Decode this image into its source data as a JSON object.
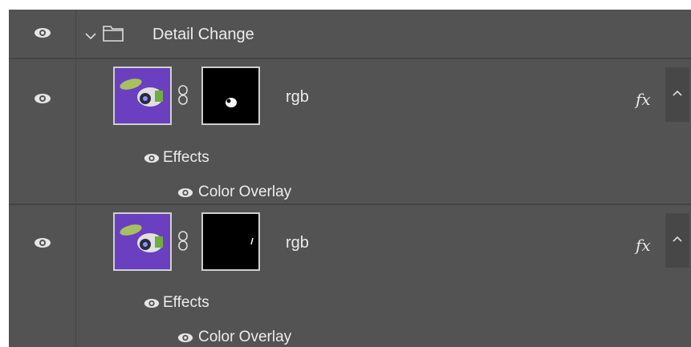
{
  "group": {
    "name": "Detail Change",
    "disclosure_icon": "chevron-down-icon",
    "folder_icon": "folder-icon",
    "visibility_icon": "eye-icon"
  },
  "layers": [
    {
      "name": "rgb",
      "fx_label": "fx",
      "effects_label": "Effects",
      "effect_items": [
        "Color Overlay"
      ],
      "visibility_icon": "eye-icon",
      "mask_icon": "link-icon"
    },
    {
      "name": "rgb",
      "fx_label": "fx",
      "effects_label": "Effects",
      "effect_items": [
        "Color Overlay"
      ],
      "visibility_icon": "eye-icon",
      "mask_icon": "link-icon"
    }
  ],
  "colors": {
    "panel_bg": "#535353",
    "thumb_bg": "#6a3fc0",
    "text": "#ececec"
  }
}
